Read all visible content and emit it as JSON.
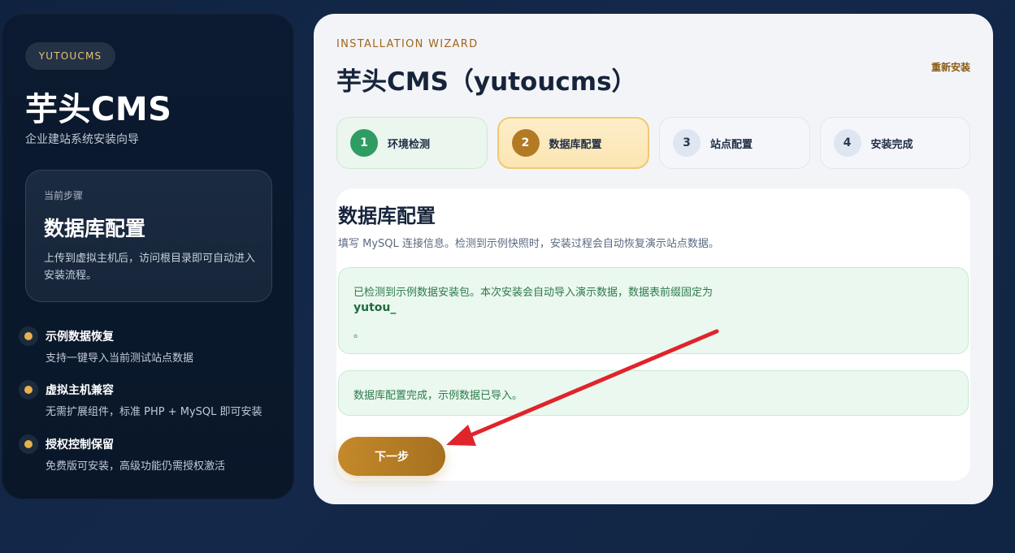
{
  "sidebar": {
    "brand_chip": "YUTOUCMS",
    "title": "芋头CMS",
    "subtitle": "企业建站系统安装向导",
    "current_step": {
      "label": "当前步骤",
      "title": "数据库配置",
      "description": "上传到虚拟主机后，访问根目录即可自动进入安装流程。"
    },
    "features": [
      {
        "title": "示例数据恢复",
        "description": "支持一键导入当前测试站点数据"
      },
      {
        "title": "虚拟主机兼容",
        "description": "无需扩展组件，标准 PHP + MySQL 即可安装"
      },
      {
        "title": "授权控制保留",
        "description": "免费版可安装，高级功能仍需授权激活"
      }
    ]
  },
  "header": {
    "wizard_label": "INSTALLATION WIZARD",
    "title": "芋头CMS（yutoucms）",
    "reinstall_link": "重新安装"
  },
  "steps": [
    {
      "num": "1",
      "label": "环境检测",
      "state": "done"
    },
    {
      "num": "2",
      "label": "数据库配置",
      "state": "active"
    },
    {
      "num": "3",
      "label": "站点配置",
      "state": "pending"
    },
    {
      "num": "4",
      "label": "安装完成",
      "state": "pending"
    }
  ],
  "content": {
    "title": "数据库配置",
    "description": "填写 MySQL 连接信息。检测到示例快照时，安装过程会自动恢复演示站点数据。",
    "notice_detected": {
      "line1": "已检测到示例数据安装包。本次安装会自动导入演示数据，数据表前缀固定为",
      "prefix": "yutou_",
      "end": "。"
    },
    "notice_done": "数据库配置完成，示例数据已导入。",
    "next_button": "下一步"
  },
  "colors": {
    "accent": "#b47a23",
    "success": "#2f9d62",
    "annotation_arrow": "#e0242b"
  }
}
